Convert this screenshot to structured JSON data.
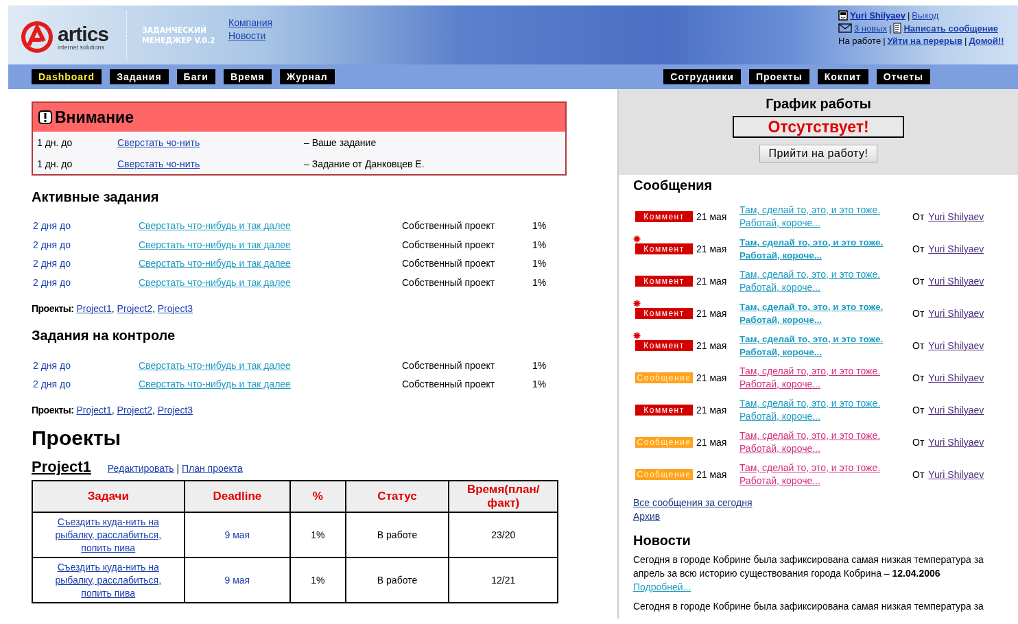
{
  "header": {
    "logo": {
      "name": "artics",
      "tagline": "internet solutions"
    },
    "product": [
      "ЗАДАНЧЕСКИЙ",
      "МЕНЕДЖЕР V.0.2"
    ],
    "links": [
      "Компания",
      "Новости"
    ],
    "user": {
      "separator": "|",
      "name": "Yuri Shilyaev",
      "logout": "Выход",
      "new_messages": "3 новых",
      "write": "Написать сообщение",
      "status": "На работе",
      "break_link": "Уйти на перерыв",
      "home": "Домой!!"
    }
  },
  "nav_left": [
    {
      "label": "Dashboard",
      "selected": true
    },
    {
      "label": "Задания",
      "selected": false
    },
    {
      "label": "Баги",
      "selected": false
    },
    {
      "label": "Время",
      "selected": false
    },
    {
      "label": "Журнал",
      "selected": false
    }
  ],
  "nav_right": [
    {
      "label": "Сотрудники",
      "selected": false
    },
    {
      "label": "Проекты",
      "selected": false
    },
    {
      "label": "Кокпит",
      "selected": false
    },
    {
      "label": "Отчеты",
      "selected": false
    }
  ],
  "attention": {
    "title": "Внимание",
    "rows": [
      {
        "due": "1 дн. до",
        "task": "Сверстать чо-нить",
        "note": "– Ваше задание"
      },
      {
        "due": "1 дн. до",
        "task": "Сверстать чо-нить",
        "note": "– Задание от Данковцев Е."
      }
    ]
  },
  "task_groups": [
    {
      "title": "Активные задания",
      "rows": [
        {
          "due": "2 дня до",
          "task": "Сверстать что-нибудь и так далее",
          "project": "Собственный проект",
          "percent": "1%"
        },
        {
          "due": "2 дня до",
          "task": "Сверстать что-нибудь и так далее",
          "project": "Собственный проект",
          "percent": "1%"
        },
        {
          "due": "2 дня до",
          "task": "Сверстать что-нибудь и так далее",
          "project": "Собственный проект",
          "percent": "1%"
        },
        {
          "due": "2 дня до",
          "task": "Сверстать что-нибудь и так далее",
          "project": "Собственный проект",
          "percent": "1%"
        }
      ],
      "projects_label": "Проекты:",
      "projects_separator": ",",
      "projects": [
        "Project1",
        "Project2",
        "Project3"
      ]
    },
    {
      "title": "Задания на контроле",
      "rows": [
        {
          "due": "2 дня до",
          "task": "Сверстать что-нибудь и так далее",
          "project": "Собственный проект",
          "percent": "1%"
        },
        {
          "due": "2 дня до",
          "task": "Сверстать что-нибудь и так далее",
          "project": "Собственный проект",
          "percent": "1%"
        }
      ],
      "projects_label": "Проекты:",
      "projects_separator": ",",
      "projects": [
        "Project1",
        "Project2",
        "Project3"
      ]
    }
  ],
  "projects": {
    "title": "Проекты",
    "project": {
      "name": "Project1",
      "links": [
        "Редактировать",
        "План проекта"
      ],
      "links_separator": "|",
      "table": {
        "columns": [
          "Задачи",
          "Deadline",
          "%",
          "Статус",
          "Время(план/ факт)"
        ],
        "rows": [
          {
            "task": "Съездить куда-нить на рыбалку, расслабиться, попить пива",
            "deadline": "9 мая",
            "percent": "1%",
            "status": "В работе",
            "time": "23/20"
          },
          {
            "task": "Съездить куда-нить на рыбалку, расслабиться, попить пива",
            "deadline": "9 мая",
            "percent": "1%",
            "status": "В работе",
            "time": "12/21"
          }
        ]
      }
    }
  },
  "schedule": {
    "title": "График работы",
    "status": "Отсутствует!",
    "button": "Прийти на работу!"
  },
  "messages": {
    "title": "Сообщения",
    "items": [
      {
        "kind": "comment",
        "badge": "Коммент",
        "unread": false,
        "date": "21 мая",
        "text": "Там, сделай то, это, и это тоже. Работай, короче...",
        "from": "От",
        "author": "Yuri Shilyaev"
      },
      {
        "kind": "comment",
        "badge": "Коммент",
        "unread": true,
        "date": "21 мая",
        "text": "Там, сделай то, это, и это тоже. Работай, короче...",
        "from": "От",
        "author": "Yuri Shilyaev"
      },
      {
        "kind": "comment",
        "badge": "Коммент",
        "unread": false,
        "date": "21 мая",
        "text": "Там, сделай то, это, и это тоже. Работай, короче...",
        "from": "От",
        "author": "Yuri Shilyaev"
      },
      {
        "kind": "comment",
        "badge": "Коммент",
        "unread": true,
        "date": "21 мая",
        "text": "Там, сделай то, это, и это тоже. Работай, короче...",
        "from": "От",
        "author": "Yuri Shilyaev"
      },
      {
        "kind": "comment",
        "badge": "Коммент",
        "unread": true,
        "date": "21 мая",
        "text": "Там, сделай то, это, и это тоже. Работай, короче...",
        "from": "От",
        "author": "Yuri Shilyaev"
      },
      {
        "kind": "message",
        "badge": "Сообщение",
        "unread": false,
        "date": "21 мая",
        "text": "Там, сделай то, это, и это тоже. Работай, короче...",
        "from": "От",
        "author": "Yuri Shilyaev"
      },
      {
        "kind": "comment",
        "badge": "Коммент",
        "unread": false,
        "date": "21 мая",
        "text": "Там, сделай то, это, и это тоже. Работай, короче...",
        "from": "От",
        "author": "Yuri Shilyaev"
      },
      {
        "kind": "message",
        "badge": "Сообщение",
        "unread": false,
        "date": "21 мая",
        "text": "Там, сделай то, это, и это тоже. Работай, короче...",
        "from": "От",
        "author": "Yuri Shilyaev"
      },
      {
        "kind": "message",
        "badge": "Сообщение",
        "unread": false,
        "date": "21 мая",
        "text": "Там, сделай то, это, и это тоже. Работай, короче...",
        "from": "От",
        "author": "Yuri Shilyaev"
      }
    ],
    "links": [
      "Все сообщения за сегодня",
      "Архив"
    ]
  },
  "news": {
    "title": "Новости",
    "items": [
      {
        "text": "Сегодня в городе Кобрине была зафиксирована самая низкая температура за апрель за всю историю существования города Кобрина  – **12.04.2006**",
        "more": "Подробней..."
      },
      {
        "text": "Сегодня в городе Кобрине была зафиксирована самая низкая температура за"
      }
    ]
  }
}
